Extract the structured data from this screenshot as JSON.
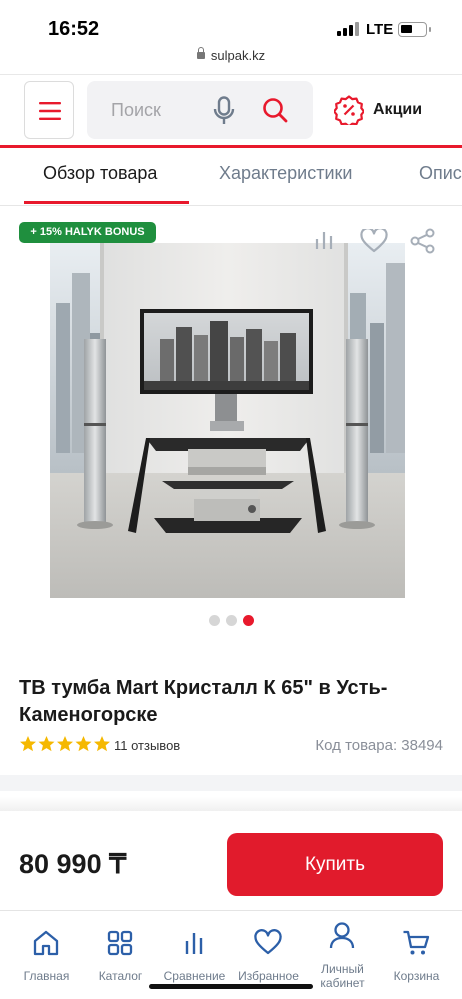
{
  "status": {
    "time": "16:52",
    "network": "LTE"
  },
  "browser": {
    "url": "sulpak.kz"
  },
  "header": {
    "search_placeholder": "Поиск",
    "promo_label": "Акции",
    "accent": "#e8192c"
  },
  "tabs": [
    {
      "label": "Обзор товара",
      "active": true
    },
    {
      "label": "Характеристики",
      "active": false
    },
    {
      "label": "Описание",
      "active": false
    }
  ],
  "product": {
    "bonus_badge": "+ 15% HALYK BONUS",
    "image_count": 3,
    "current_image": 3,
    "title": "ТВ тумба Mart Кристалл К 65\" в Усть-Каменогорске",
    "rating": 5,
    "reviews": "11 отзывов",
    "code": "Код товара: 38494",
    "price": "80 990 ₸",
    "buy_label": "Купить",
    "badge_color": "#1f8f3e"
  },
  "bottom_nav": [
    {
      "label": "Главная",
      "icon": "home-icon"
    },
    {
      "label": "Каталог",
      "icon": "catalog-icon"
    },
    {
      "label": "Сравнение",
      "icon": "compare-icon"
    },
    {
      "label": "Избранное",
      "icon": "heart-icon"
    },
    {
      "label": "Личный кабинет",
      "icon": "user-icon"
    },
    {
      "label": "Корзина",
      "icon": "cart-icon"
    }
  ]
}
